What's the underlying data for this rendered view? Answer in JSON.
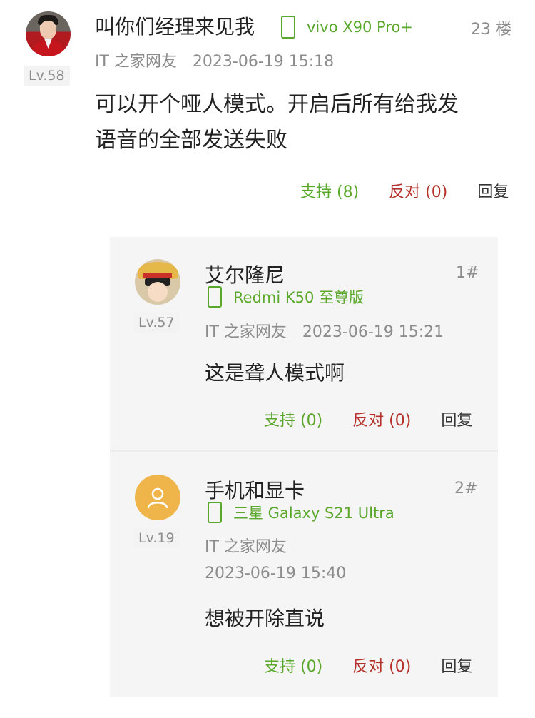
{
  "main_comment": {
    "username": "叫你们经理来见我",
    "device": "vivo X90 Pro+",
    "floor": "23 楼",
    "level": "Lv.58",
    "source": "IT 之家网友",
    "timestamp": "2023-06-19 15:18",
    "content_line1": "可以开个哑人模式。开启后所有给我发",
    "content_line2": "语音的全部发送失败",
    "support_label": "支持 (8)",
    "oppose_label": "反对 (0)",
    "reply_label": "回复"
  },
  "replies": [
    {
      "username": "艾尔隆尼",
      "device": "Redmi K50 至尊版",
      "floor": "1#",
      "level": "Lv.57",
      "source": "IT 之家网友",
      "timestamp": "2023-06-19 15:21",
      "content": "这是聋人模式啊",
      "support_label": "支持 (0)",
      "oppose_label": "反对 (0)",
      "reply_label": "回复"
    },
    {
      "username": "手机和显卡",
      "device": "三星 Galaxy S21 Ultra",
      "floor": "2#",
      "level": "Lv.19",
      "source": "IT 之家网友",
      "timestamp": "2023-06-19 15:40",
      "content": "想被开除直说",
      "support_label": "支持 (0)",
      "oppose_label": "反对 (0)",
      "reply_label": "回复"
    }
  ],
  "colors": {
    "accent_green": "#5aa82b",
    "oppose_red": "#b5312a",
    "meta_gray": "#8c8c8c",
    "reply_bg": "#f5f5f5",
    "default_avatar": "#f0b54a"
  },
  "icons": {
    "device": "phone-outline-icon",
    "default_avatar": "user-silhouette-icon"
  }
}
